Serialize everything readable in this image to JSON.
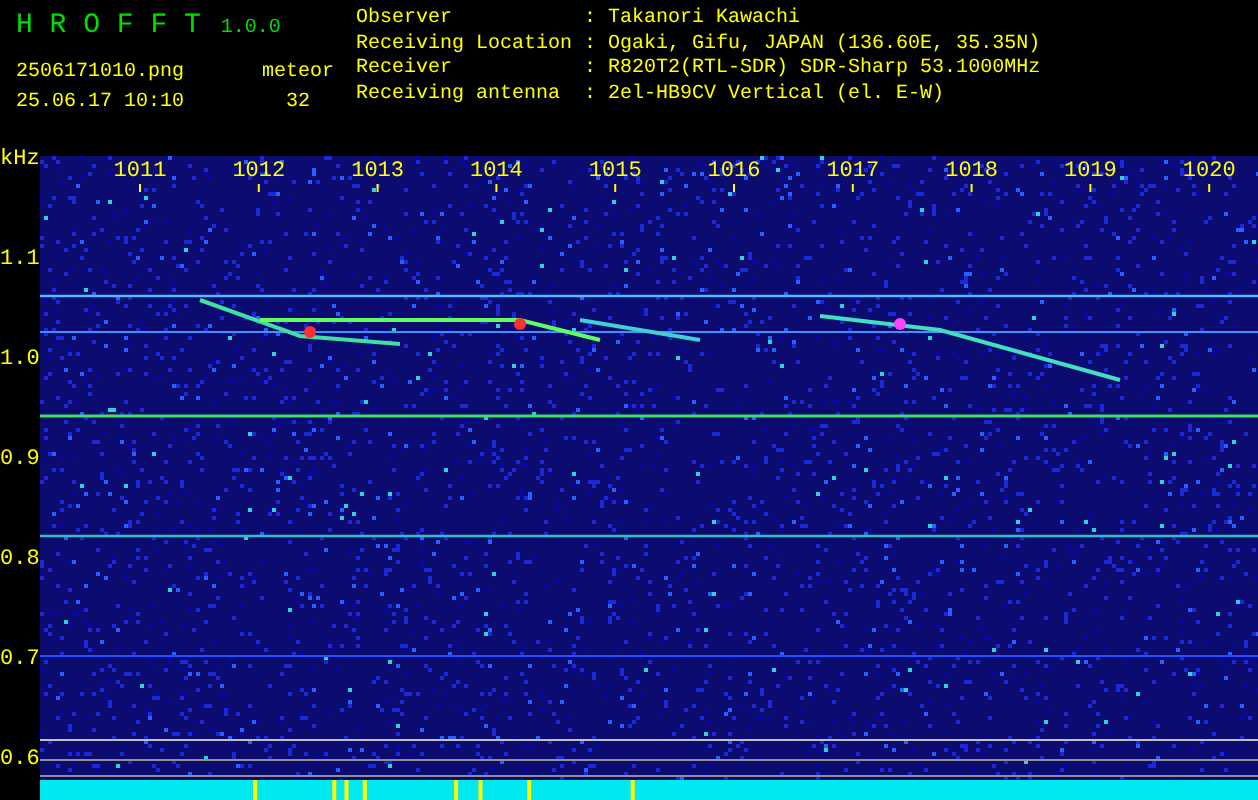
{
  "app": {
    "title": "H R O F F T",
    "version": "1.0.0",
    "filename": "2506171010.png",
    "datetime": "25.06.17 10:10",
    "count_label": "meteor",
    "count": "32"
  },
  "info": [
    {
      "label": "Observer",
      "value": ": Takanori Kawachi"
    },
    {
      "label": "Receiving Location",
      "value": ": Ogaki, Gifu, JAPAN (136.60E, 35.35N)"
    },
    {
      "label": "Receiver",
      "value": ": R820T2(RTL-SDR) SDR-Sharp 53.1000MHz"
    },
    {
      "label": "Receiving antenna",
      "value": ": 2el-HB9CV Vertical (el. E-W)"
    }
  ],
  "spectrogram": {
    "y_unit": "kHz",
    "x_labels": [
      "1011",
      "1012",
      "1013",
      "1014",
      "1015",
      "1016",
      "1017",
      "1018",
      "1019",
      "1020"
    ],
    "y_labels": [
      "1.1",
      "1.0",
      "0.9",
      "0.8",
      "0.7",
      "0.6"
    ]
  }
}
